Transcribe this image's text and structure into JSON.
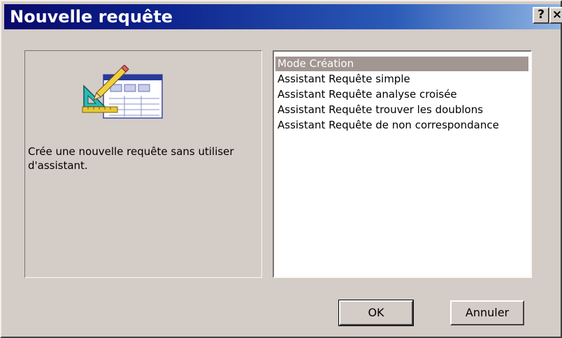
{
  "window": {
    "title": "Nouvelle requête",
    "help_label": "?",
    "close_label": "×"
  },
  "info": {
    "icon": "query-design-icon",
    "description": "Crée une nouvelle requête sans utiliser d'assistant."
  },
  "list": {
    "items": [
      {
        "label": "Mode Création",
        "selected": true
      },
      {
        "label": "Assistant Requête simple",
        "selected": false
      },
      {
        "label": "Assistant Requête analyse croisée",
        "selected": false
      },
      {
        "label": "Assistant Requête trouver les doublons",
        "selected": false
      },
      {
        "label": "Assistant Requête de non correspondance",
        "selected": false
      }
    ]
  },
  "buttons": {
    "ok_label": "OK",
    "cancel_label": "Annuler"
  },
  "colors": {
    "dialog_bg": "#d4ccc6",
    "selection_bg": "#a29692",
    "title_start": "#0a0a6a",
    "title_end": "#8fb4e3"
  }
}
